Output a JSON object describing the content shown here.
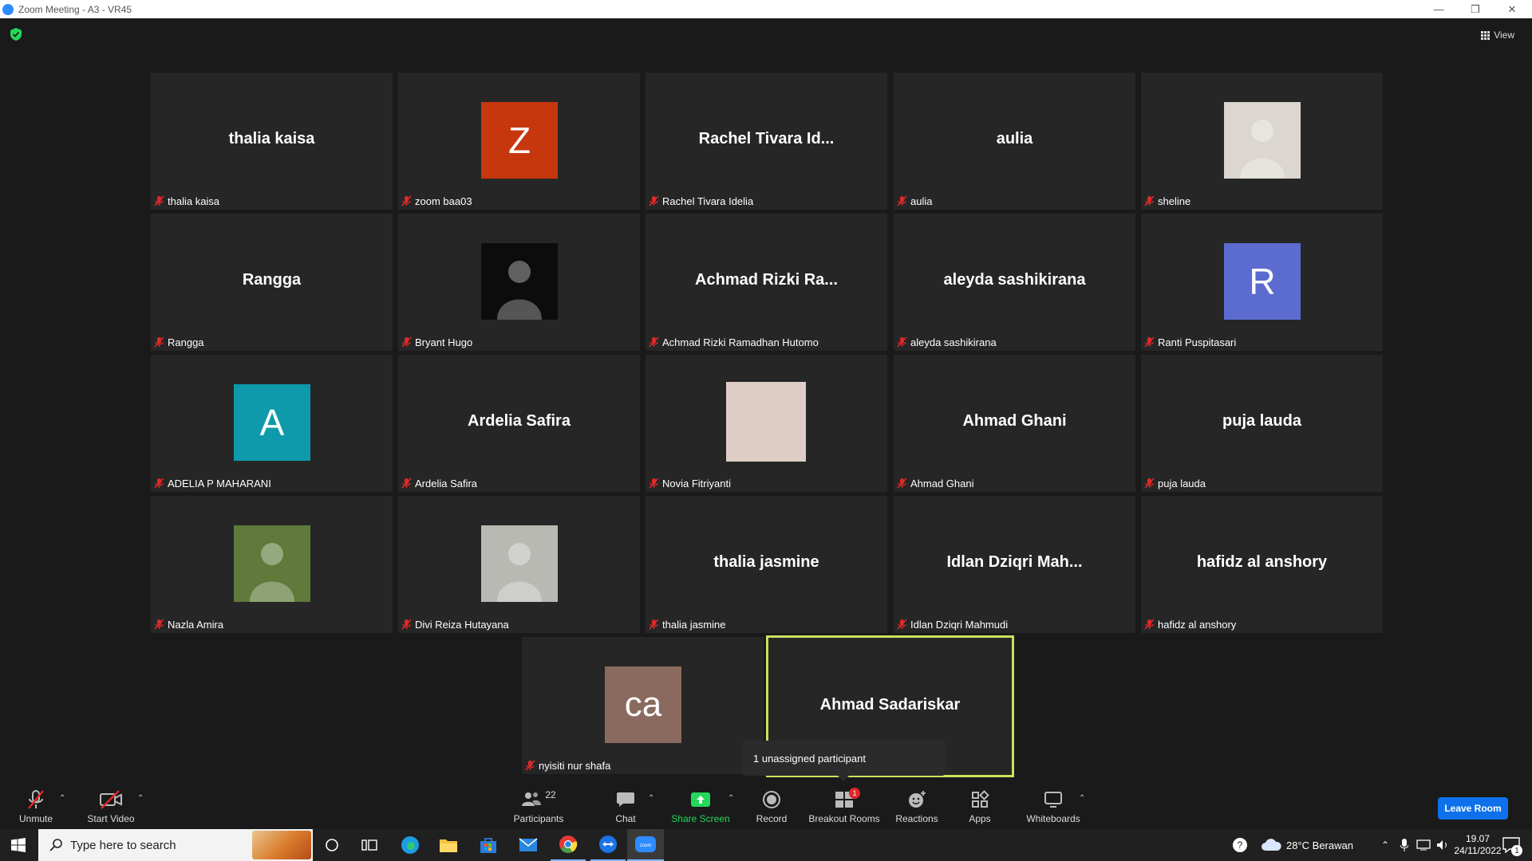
{
  "window": {
    "title": "Zoom Meeting - A3 - VR45"
  },
  "view_button": {
    "label": "View"
  },
  "tiles": [
    {
      "display": "thalia kaisa",
      "label": "thalia kaisa",
      "type": "text"
    },
    {
      "display": "Z",
      "label": "zoom baa03",
      "type": "avatar",
      "color": "#c7370e"
    },
    {
      "display": "Rachel Tivara Id...",
      "label": "Rachel Tivara Idelia",
      "type": "text"
    },
    {
      "display": "aulia",
      "label": "aulia",
      "type": "text"
    },
    {
      "display": "",
      "label": "sheline",
      "type": "photo",
      "color": "#dcd6d0"
    },
    {
      "display": "Rangga",
      "label": "Rangga",
      "type": "text"
    },
    {
      "display": "",
      "label": "Bryant Hugo",
      "type": "photo",
      "color": "#0c0c0c"
    },
    {
      "display": "Achmad Rizki Ra...",
      "label": "Achmad Rizki Ramadhan Hutomo",
      "type": "text"
    },
    {
      "display": "aleyda sashikirana",
      "label": "aleyda sashikirana",
      "type": "text"
    },
    {
      "display": "R",
      "label": "Ranti Puspitasari",
      "type": "avatar",
      "color": "#5b6bd0"
    },
    {
      "display": "A",
      "label": "ADELIA P MAHARANI",
      "type": "avatar",
      "color": "#0f9aab"
    },
    {
      "display": "Ardelia Safira",
      "label": "Ardelia Safira",
      "type": "text"
    },
    {
      "display": "",
      "label": "Novia Fitriyanti",
      "type": "plain",
      "color": "#ddcdc4"
    },
    {
      "display": "Ahmad Ghani",
      "label": "Ahmad Ghani",
      "type": "text"
    },
    {
      "display": "puja lauda",
      "label": "puja lauda",
      "type": "text"
    },
    {
      "display": "",
      "label": "Nazla Amira",
      "type": "photo",
      "color": "#5f7a3a"
    },
    {
      "display": "",
      "label": "Divi Reiza Hutayana",
      "type": "photo",
      "color": "#b9b9b4"
    },
    {
      "display": "thalia jasmine",
      "label": "thalia jasmine",
      "type": "text"
    },
    {
      "display": "Idlan Dziqri Mah...",
      "label": "Idlan Dziqri Mahmudi",
      "type": "text"
    },
    {
      "display": "hafidz al anshory",
      "label": "hafidz al anshory",
      "type": "text"
    },
    {
      "display": "ca",
      "label": "nyisiti nur shafa",
      "type": "avatar",
      "color": "#8a6a5e"
    },
    {
      "display": "Ahmad Sadariskar",
      "label": "",
      "type": "text",
      "active": true
    }
  ],
  "tooltip": {
    "text": "1 unassigned participant"
  },
  "toolbar": {
    "unmute": "Unmute",
    "start_video": "Start Video",
    "participants": "Participants",
    "participants_count": "22",
    "chat": "Chat",
    "share_screen": "Share Screen",
    "record": "Record",
    "breakout_rooms": "Breakout Rooms",
    "breakout_badge": "1",
    "reactions": "Reactions",
    "apps": "Apps",
    "whiteboards": "Whiteboards",
    "leave": "Leave Room"
  },
  "taskbar": {
    "search_placeholder": "Type here to search",
    "weather": "28°C  Berawan",
    "time": "19.07",
    "date": "24/11/2022",
    "notifications": "1"
  }
}
